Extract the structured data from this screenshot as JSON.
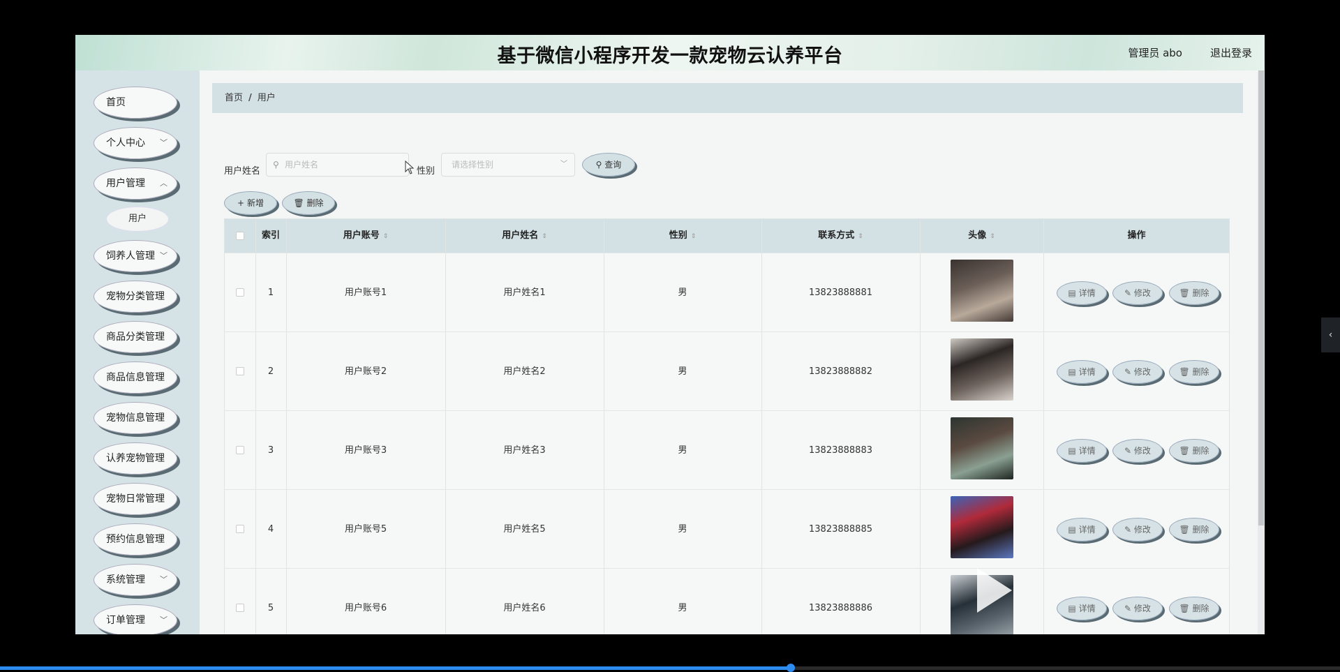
{
  "header": {
    "title": "基于微信小程序开发一款宠物云认养平台",
    "user": "管理员 abo",
    "logout": "退出登录"
  },
  "sidebar": {
    "items": [
      {
        "label": "首页",
        "expandable": false
      },
      {
        "label": "个人中心",
        "expandable": true
      },
      {
        "label": "用户管理",
        "expandable": true
      },
      {
        "label": "饲养人管理",
        "expandable": true
      },
      {
        "label": "宠物分类管理",
        "expandable": false
      },
      {
        "label": "商品分类管理",
        "expandable": false
      },
      {
        "label": "商品信息管理",
        "expandable": false
      },
      {
        "label": "宠物信息管理",
        "expandable": false
      },
      {
        "label": "认养宠物管理",
        "expandable": false
      },
      {
        "label": "宠物日常管理",
        "expandable": false
      },
      {
        "label": "预约信息管理",
        "expandable": false
      },
      {
        "label": "系统管理",
        "expandable": true
      },
      {
        "label": "订单管理",
        "expandable": true
      }
    ],
    "submenu": {
      "label": "用户"
    }
  },
  "breadcrumb": {
    "home": "首页",
    "sep": "/",
    "current": "用户"
  },
  "search": {
    "name_label": "用户姓名",
    "name_placeholder": "用户姓名",
    "gender_label": "性别",
    "gender_placeholder": "请选择性别",
    "query_button": "查询"
  },
  "toolbar": {
    "add": "新增",
    "delete": "删除"
  },
  "table": {
    "columns": [
      "索引",
      "用户账号",
      "用户姓名",
      "性别",
      "联系方式",
      "头像",
      "操作"
    ],
    "rows": [
      {
        "index": "1",
        "account": "用户账号1",
        "name": "用户姓名1",
        "gender": "男",
        "phone": "13823888881"
      },
      {
        "index": "2",
        "account": "用户账号2",
        "name": "用户姓名2",
        "gender": "男",
        "phone": "13823888882"
      },
      {
        "index": "3",
        "account": "用户账号3",
        "name": "用户姓名3",
        "gender": "男",
        "phone": "13823888883"
      },
      {
        "index": "4",
        "account": "用户账号5",
        "name": "用户姓名5",
        "gender": "男",
        "phone": "13823888885"
      },
      {
        "index": "5",
        "account": "用户账号6",
        "name": "用户姓名6",
        "gender": "男",
        "phone": "13823888886"
      }
    ],
    "actions": {
      "detail": "详情",
      "edit": "修改",
      "delete": "删除"
    }
  },
  "video": {
    "progress": 0.59
  },
  "colors": {
    "accent": "#d3e1e5",
    "sidebar": "#d6e3e6",
    "progress": "#2d8cf0"
  }
}
